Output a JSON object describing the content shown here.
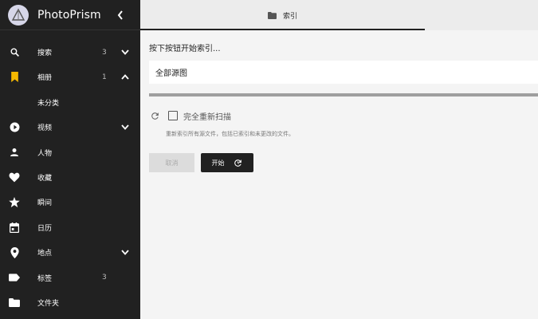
{
  "app": {
    "name": "PhotoPrism"
  },
  "sidebar": {
    "items": [
      {
        "label": "搜索",
        "count": "3",
        "icon": "search-icon",
        "chevron": "down"
      },
      {
        "label": "相册",
        "count": "1",
        "icon": "bookmark-icon",
        "chevron": "up"
      },
      {
        "label": "未分类",
        "count": "",
        "icon": "",
        "chevron": ""
      },
      {
        "label": "视频",
        "count": "",
        "icon": "play-icon",
        "chevron": "down"
      },
      {
        "label": "人物",
        "count": "",
        "icon": "person-icon",
        "chevron": ""
      },
      {
        "label": "收藏",
        "count": "",
        "icon": "heart-icon",
        "chevron": ""
      },
      {
        "label": "瞬间",
        "count": "",
        "icon": "star-icon",
        "chevron": ""
      },
      {
        "label": "日历",
        "count": "",
        "icon": "calendar-icon",
        "chevron": ""
      },
      {
        "label": "地点",
        "count": "",
        "icon": "place-icon",
        "chevron": "down"
      },
      {
        "label": "标签",
        "count": "3",
        "icon": "label-icon",
        "chevron": ""
      },
      {
        "label": "文件夹",
        "count": "",
        "icon": "folder-icon",
        "chevron": ""
      }
    ]
  },
  "tab": {
    "label": "索引",
    "icon": "folder-icon"
  },
  "index": {
    "prompt": "按下按钮开始索引...",
    "source": "全部源图",
    "progress": 1.0,
    "rescan_label": "完全重新扫描",
    "hint": "重新索引所有源文件，包括已索引和未更改的文件。",
    "cancel_label": "取消",
    "start_label": "开始"
  },
  "colors": {
    "sidebar_bg": "#212121",
    "bookmark_accent": "#f5b800",
    "page_bg": "#f4f4f4"
  }
}
